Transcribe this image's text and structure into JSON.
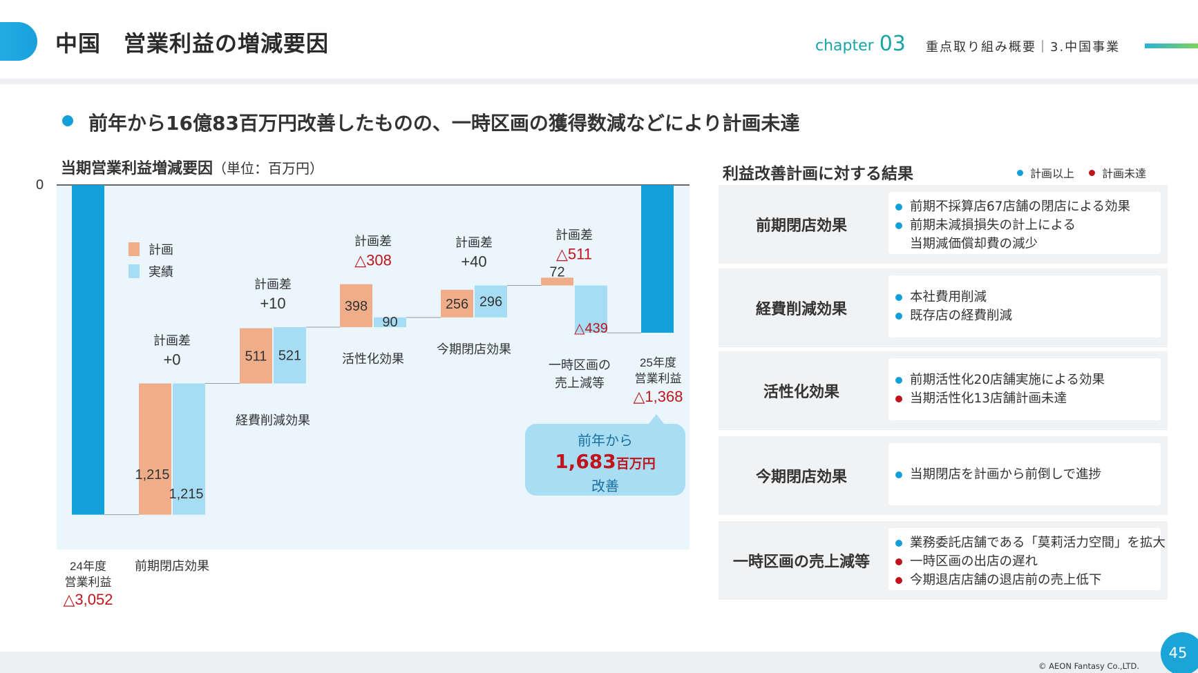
{
  "header": {
    "title": "中国　営業利益の増減要因",
    "chapter_word": "chapter",
    "chapter_num": "03",
    "section": "重点取り組み概要｜3.中国事業"
  },
  "lead": "前年から16億83百万円改善したものの、一時区画の獲得数減などにより計画未達",
  "chart_title": "当期営業利益増減要因",
  "chart_unit": "（単位：百万円）",
  "note": {
    "line1": "前年から",
    "amount": "1,683",
    "unit": "百万円",
    "line3": "改善"
  },
  "chart_data": {
    "type": "bar",
    "subtype": "waterfall",
    "title": "当期営業利益増減要因",
    "unit": "（単位：百万円）",
    "y_axis_tick": "0",
    "legend": [
      {
        "name": "計画",
        "color": "#f0ad8a"
      },
      {
        "name": "実績",
        "color": "#a6dcf4"
      }
    ],
    "start": {
      "label_lines": [
        "24年度",
        "営業利益"
      ],
      "value": -3052,
      "value_label": "△3,052"
    },
    "end": {
      "label_lines": [
        "25年度",
        "営業利益"
      ],
      "value": -1368,
      "value_label": "△1,368"
    },
    "factors": [
      {
        "label_lines": [
          "前期閉店効果"
        ],
        "plan": 1215,
        "actual": 1215,
        "plan_label": "1,215",
        "actual_label": "1,215",
        "diff_title": "計画差",
        "diff": "+0"
      },
      {
        "label_lines": [
          "経費削減効果"
        ],
        "plan": 511,
        "actual": 521,
        "plan_label": "511",
        "actual_label": "521",
        "diff_title": "計画差",
        "diff": "+10"
      },
      {
        "label_lines": [
          "活性化効果"
        ],
        "plan": 398,
        "actual": 90,
        "plan_label": "398",
        "actual_label": "90",
        "diff_title": "計画差",
        "diff": "△308"
      },
      {
        "label_lines": [
          "今期閉店効果"
        ],
        "plan": 256,
        "actual": 296,
        "plan_label": "256",
        "actual_label": "296",
        "diff_title": "計画差",
        "diff": "+40"
      },
      {
        "label_lines": [
          "一時区画の",
          "売上減等"
        ],
        "plan": 72,
        "actual": -439,
        "plan_label": "72",
        "actual_label": "△439",
        "diff_title": "計画差",
        "diff": "△511"
      }
    ],
    "colors": {
      "total": "#14a0da",
      "plan": "#f0ad8a",
      "actual": "#a6dcf4",
      "negative_text": "#c0141c",
      "plot_bg": "#eaf6fc"
    }
  },
  "right_panel": {
    "title": "利益改善計画に対する結果",
    "legend": [
      {
        "label": "計画以上",
        "color": "#139fd8"
      },
      {
        "label": "計画未達",
        "color": "#c0141c"
      }
    ],
    "rows": [
      {
        "label": "前期閉店効果",
        "items": [
          {
            "text": "前期不採算店67店舗の閉店による効果",
            "color": "#139fd8"
          },
          {
            "text": "前期未減損損失の計上による",
            "color": "#139fd8"
          },
          {
            "text": "当期減価償却費の減少",
            "continuation": true
          }
        ]
      },
      {
        "label": "経費削減効果",
        "items": [
          {
            "text": "本社費用削減",
            "color": "#139fd8"
          },
          {
            "text": "既存店の経費削減",
            "color": "#139fd8"
          }
        ]
      },
      {
        "label": "活性化効果",
        "items": [
          {
            "text": "前期活性化20店舗実施による効果",
            "color": "#139fd8"
          },
          {
            "text": "当期活性化13店舗計画未達",
            "color": "#c0141c"
          }
        ]
      },
      {
        "label": "今期閉店効果",
        "items": [
          {
            "text": "当期閉店を計画から前倒しで進捗",
            "color": "#139fd8"
          }
        ]
      },
      {
        "label": "一時区画の売上減等",
        "items": [
          {
            "text": "業務委託店舗である「莫莉活力空間」を拡大",
            "color": "#139fd8"
          },
          {
            "text": "一時区画の出店の遅れ",
            "color": "#c0141c"
          },
          {
            "text": "今期退店店舗の退店前の売上低下",
            "color": "#c0141c"
          }
        ]
      }
    ]
  },
  "footer": {
    "copyright": "© AEON Fantasy Co.,LTD.",
    "page": "45"
  }
}
